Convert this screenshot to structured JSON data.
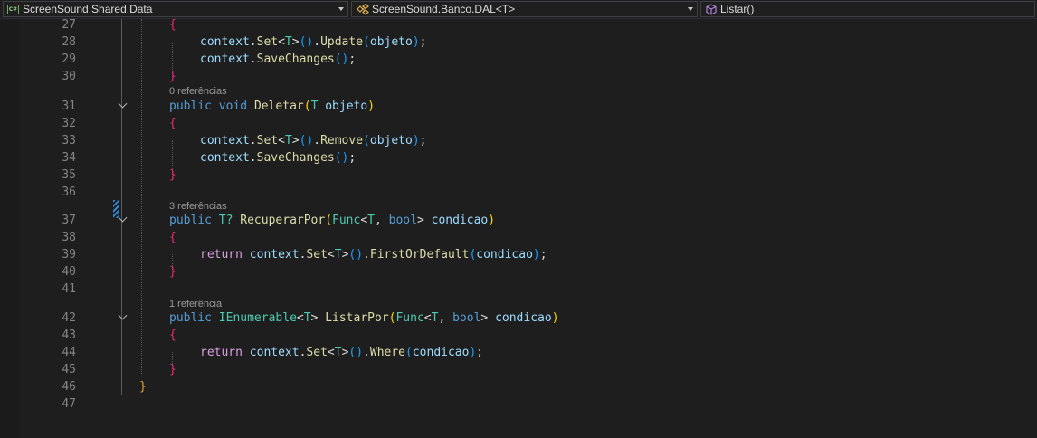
{
  "navbar": {
    "project": "ScreenSound.Shared.Data",
    "class": "ScreenSound.Banco.DAL<T>",
    "member": "Listar()"
  },
  "icons": {
    "project": "csharp-project-icon",
    "class": "class-icon",
    "member": "method-cube-icon"
  },
  "colors": {
    "background": "#1e1e1e",
    "keyword": "#569cd6",
    "control_keyword": "#d8a0df",
    "type": "#4ec9b0",
    "method": "#dcdcaa",
    "parameter": "#9cdcfe",
    "brace_method": "#e8287a",
    "brace_class": "#e5a02b",
    "change_marker": "#2a8ad4"
  },
  "lines": {
    "n27": "27",
    "n28": "28",
    "n29": "29",
    "n30": "30",
    "n31": "31",
    "n32": "32",
    "n33": "33",
    "n34": "34",
    "n35": "35",
    "n36": "36",
    "n37": "37",
    "n38": "38",
    "n39": "39",
    "n40": "40",
    "n41": "41",
    "n42": "42",
    "n43": "43",
    "n44": "44",
    "n45": "45",
    "n46": "46",
    "n47": "47"
  },
  "lens": {
    "deletar": "0 referências",
    "recuperar": "3 referências",
    "listar": "1 referência"
  },
  "tokens": {
    "open_brace": "{",
    "close_brace": "}",
    "context": "context",
    "dot": ".",
    "set": "Set",
    "lt": "<",
    "gt": ">",
    "T": "T",
    "paren_open": "(",
    "paren_close": ")",
    "parens": "()",
    "semicolon": ";",
    "comma": ", ",
    "update": "Update",
    "remove": "Remove",
    "save_changes": "SaveChanges",
    "objeto": "objeto",
    "public": "public ",
    "void": "void ",
    "deletar": "Deletar",
    "T_space": "T ",
    "T_nullable": "T? ",
    "recuperar_por": "RecuperarPor",
    "func": "Func",
    "bool": "bool",
    "condicao": "condicao",
    "return": "return ",
    "first_or_default": "FirstOrDefault",
    "where": "Where",
    "ienumerable": "IEnumerable",
    "listar_por": "ListarPor",
    "space": " "
  }
}
